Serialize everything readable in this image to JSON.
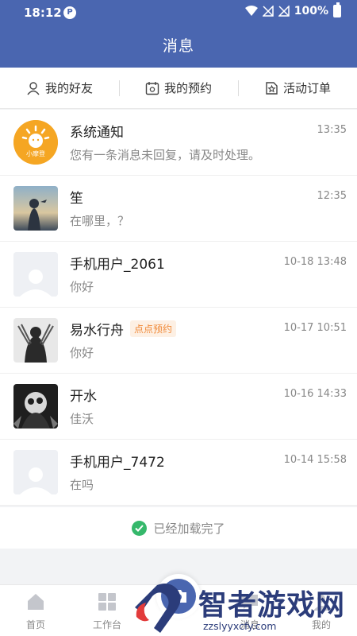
{
  "status_bar": {
    "time": "18:12",
    "battery": "100%"
  },
  "header": {
    "title": "消息"
  },
  "tabs": [
    {
      "label": "我的好友",
      "icon": "user-icon"
    },
    {
      "label": "我的预约",
      "icon": "calendar-icon"
    },
    {
      "label": "活动订单",
      "icon": "star-ticket-icon"
    }
  ],
  "conversations": [
    {
      "name": "系统通知",
      "time": "13:35",
      "message": "您有一条消息未回复，请及时处理。",
      "badge": "",
      "avatar": "logo-avatar",
      "logo_text": "小摩登"
    },
    {
      "name": "笙",
      "time": "12:35",
      "message": "在哪里，？",
      "badge": "",
      "avatar": "photo-avatar"
    },
    {
      "name": "手机用户_2061",
      "time": "10-18 13:48",
      "message": "你好",
      "badge": "",
      "avatar": "default-avatar"
    },
    {
      "name": "易水行舟",
      "time": "10-17 10:51",
      "message": "你好",
      "badge": "点点预约",
      "avatar": "photo-avatar"
    },
    {
      "name": "开水",
      "time": "10-16 14:33",
      "message": "佳沃",
      "badge": "",
      "avatar": "photo-avatar"
    },
    {
      "name": "手机用户_7472",
      "time": "10-14 15:58",
      "message": "在吗",
      "badge": "",
      "avatar": "default-avatar"
    }
  ],
  "footer": {
    "loaded_text": "已经加载完了"
  },
  "bottom_nav": [
    {
      "label": "首页",
      "icon": "home-icon"
    },
    {
      "label": "工作台",
      "icon": "grid-icon"
    },
    {
      "label": "",
      "icon": "camera-icon"
    },
    {
      "label": "消息",
      "icon": "message-icon"
    },
    {
      "label": "我的",
      "icon": "profile-icon"
    }
  ],
  "watermark": {
    "text": "智者游戏网",
    "url": "zzslyyxcfy.com"
  },
  "colors": {
    "primary": "#4a66b0",
    "badge_text": "#f08a3a",
    "success": "#35b86b"
  }
}
